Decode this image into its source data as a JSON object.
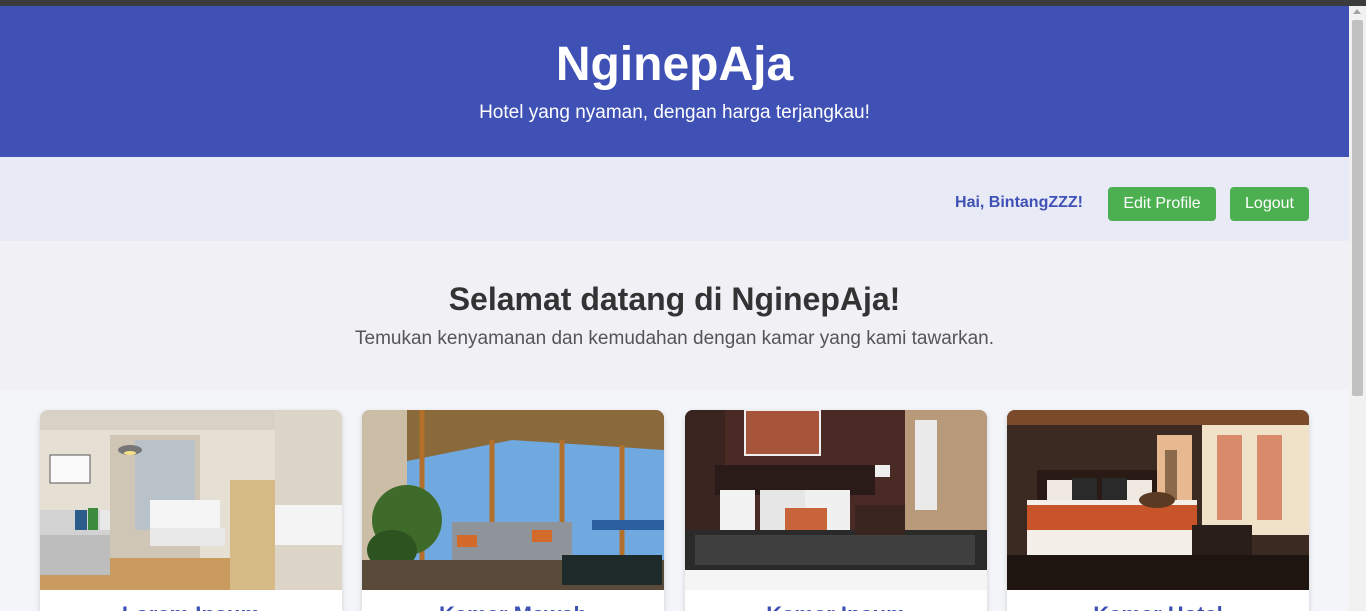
{
  "header": {
    "title": "NginepAja",
    "tagline": "Hotel yang nyaman, dengan harga terjangkau!"
  },
  "nav": {
    "greeting": "Hai, BintangZZZ!",
    "edit_profile": "Edit Profile",
    "logout": "Logout"
  },
  "welcome": {
    "heading": "Selamat datang di NginepAja!",
    "subtext": "Temukan kenyamanan dan kemudahan dengan kamar yang kami tawarkan."
  },
  "rooms": [
    {
      "title": "Lorem Ipsum"
    },
    {
      "title": "Kamar Mewah"
    },
    {
      "title": "Kamar Ipsum"
    },
    {
      "title": "Kamar Hotel"
    }
  ],
  "colors": {
    "primary": "#3f51b5",
    "nav_bg": "#e8eaf6",
    "button": "#4caf50"
  }
}
